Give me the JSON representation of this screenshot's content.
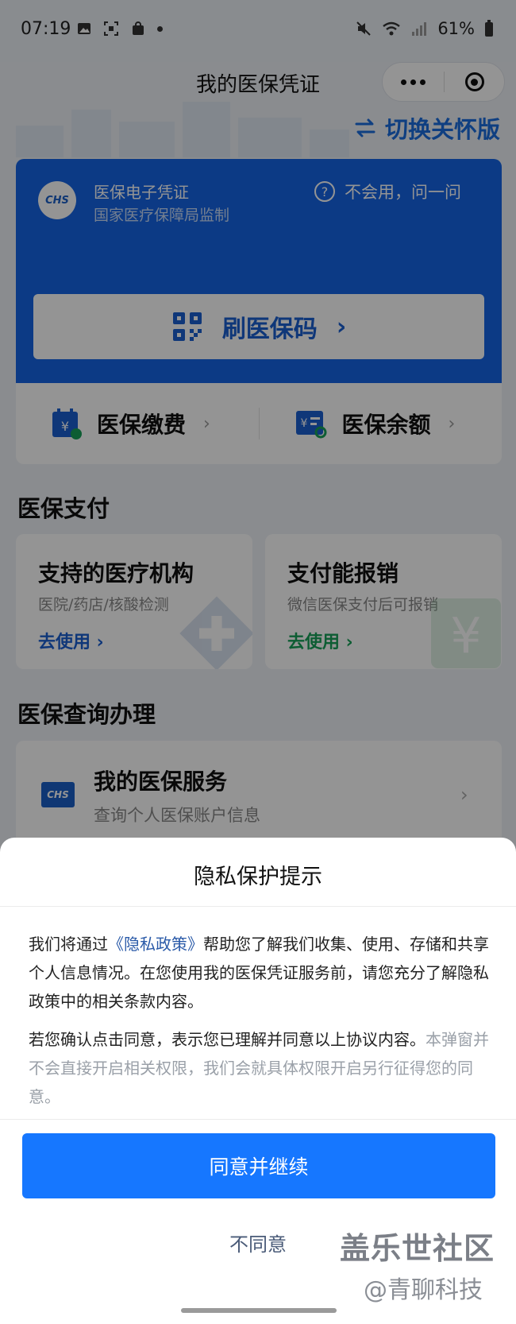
{
  "status_bar": {
    "time": "07:19",
    "battery": "61%"
  },
  "header": {
    "title": "我的医保凭证"
  },
  "care_mode": {
    "label": "切换关怀版"
  },
  "card": {
    "logo_text": "CHS",
    "title": "医保电子凭证",
    "subtitle": "国家医疗保障局监制",
    "help_label": "不会用，问一问",
    "scan_label": "刷医保码",
    "actions": [
      {
        "label": "医保缴费"
      },
      {
        "label": "医保余额"
      }
    ]
  },
  "payment": {
    "section_title": "医保支付",
    "cards": [
      {
        "title": "支持的医疗机构",
        "subtitle": "医院/药店/核酸检测",
        "action": "去使用",
        "accent": "#1a5fd0"
      },
      {
        "title": "支付能报销",
        "subtitle": "微信医保支付后可报销",
        "action": "去使用",
        "accent": "#18a058"
      }
    ]
  },
  "query": {
    "section_title": "医保查询办理",
    "service": {
      "logo_text": "CHS",
      "title": "我的医保服务",
      "subtitle": "查询个人医保账户信息"
    }
  },
  "privacy_sheet": {
    "title": "隐私保护提示",
    "para1_before": "我们将通过",
    "para1_link": "《隐私政策》",
    "para1_after": "帮助您了解我们收集、使用、存储和共享个人信息情况。在您使用我的医保凭证服务前，请您充分了解隐私政策中的相关条款内容。",
    "para2_main": "若您确认点击同意，表示您已理解并同意以上协议内容。",
    "para2_muted": "本弹窗并不会直接开启相关权限，我们会就具体权限开启另行征得您的同意。",
    "agree_label": "同意并继续",
    "disagree_label": "不同意"
  },
  "watermark": {
    "line1": "盖乐世社区",
    "line2": "@青聊科技"
  },
  "colors": {
    "primary_blue": "#1565e6",
    "button_blue": "#1677ff",
    "link_blue": "#2a5aa8"
  }
}
